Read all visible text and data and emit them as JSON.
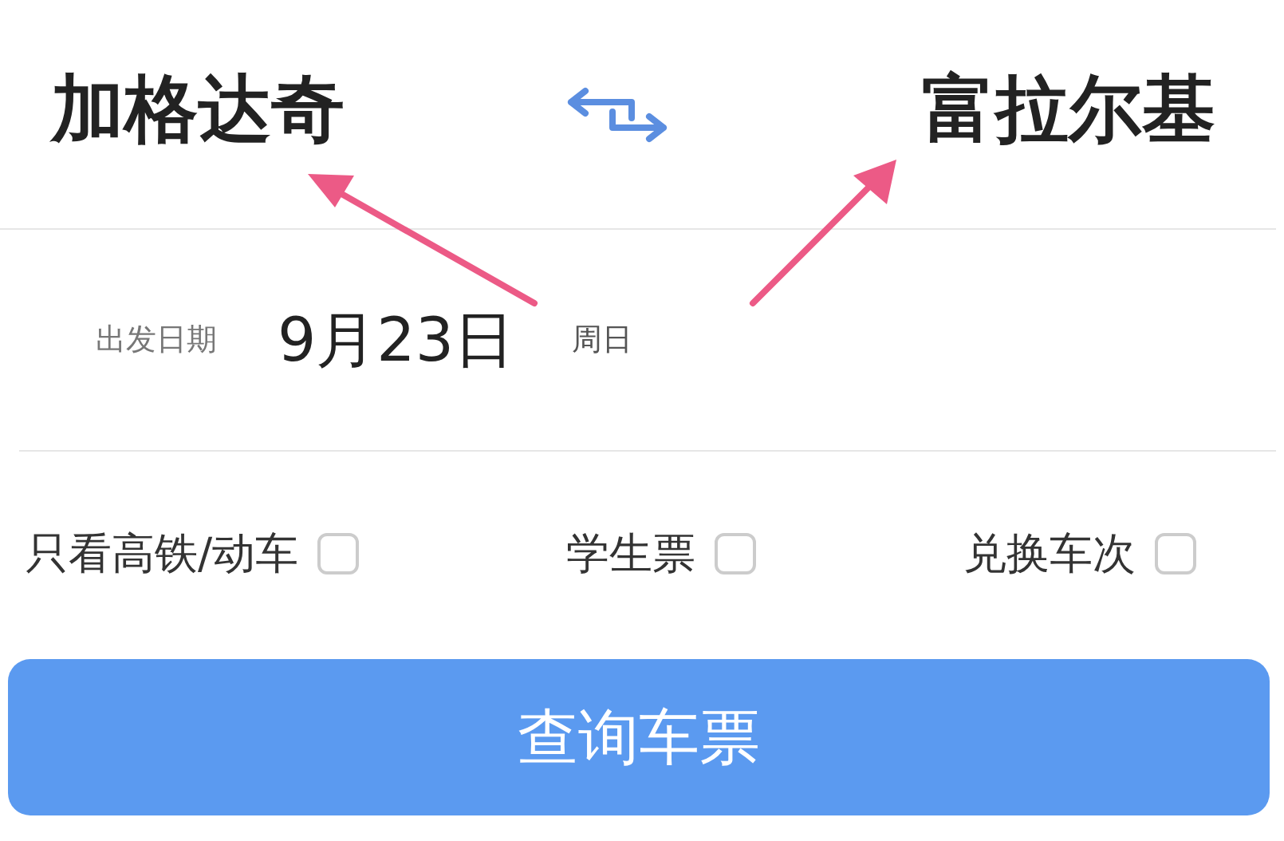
{
  "route": {
    "from": "加格达奇",
    "to": "富拉尔基"
  },
  "date": {
    "label": "出发日期",
    "value": "9月23日",
    "weekday": "周日"
  },
  "options": [
    {
      "label": "只看高铁/动车",
      "checked": false
    },
    {
      "label": "学生票",
      "checked": false
    },
    {
      "label": "兑换车次",
      "checked": false
    }
  ],
  "search_button": "查询车票"
}
